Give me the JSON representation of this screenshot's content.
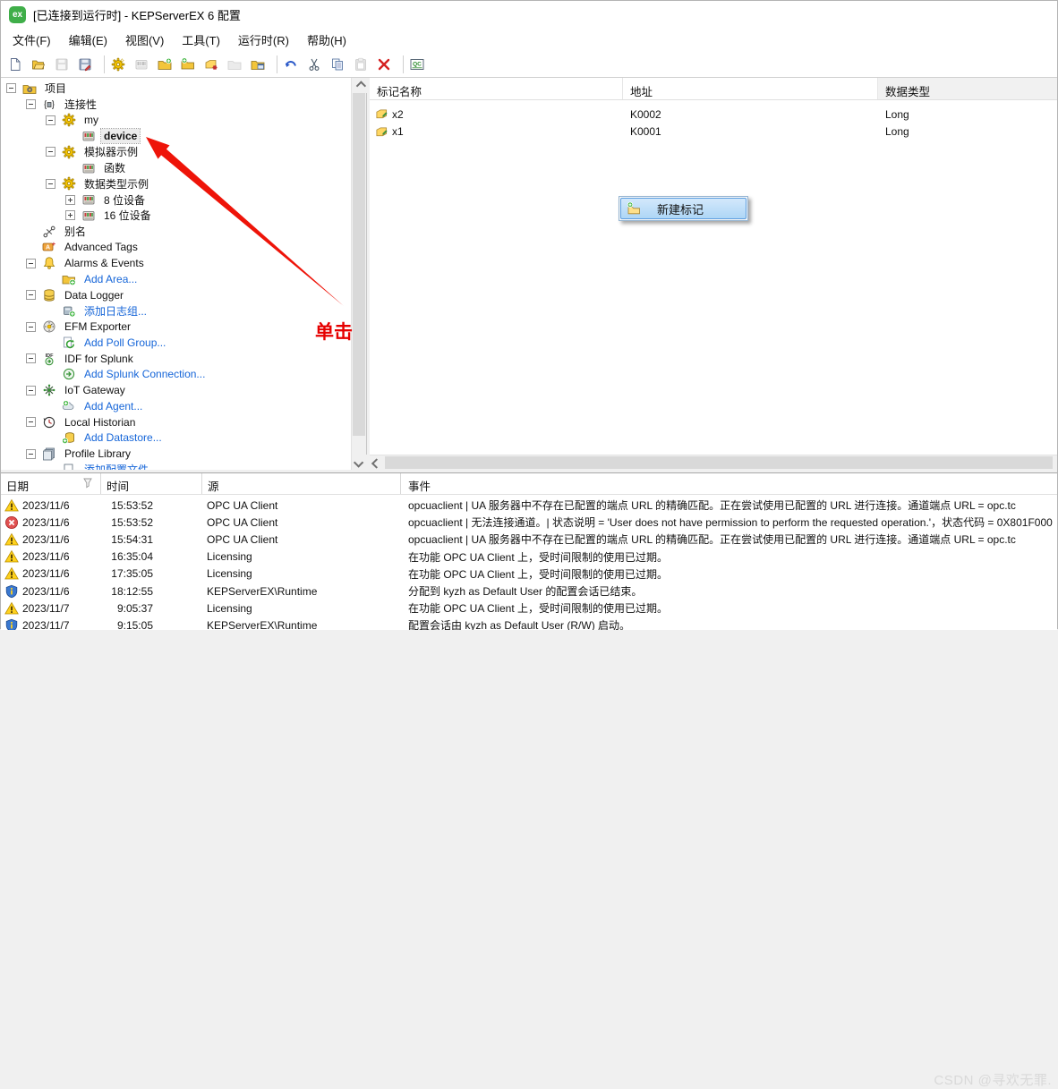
{
  "window": {
    "title": "[已连接到运行时] - KEPServerEX 6 配置",
    "app_icon": "kepserverex-logo",
    "app_icon_color": "#3fae49",
    "app_icon_text": "ex"
  },
  "menu_bar": {
    "items": [
      "文件(F)",
      "编辑(E)",
      "视图(V)",
      "工具(T)",
      "运行时(R)",
      "帮助(H)"
    ]
  },
  "toolbar": {
    "buttons": [
      {
        "icon": "new-project",
        "enabled": true
      },
      {
        "icon": "open-project",
        "enabled": true
      },
      {
        "icon": "save-project",
        "enabled": false
      },
      {
        "icon": "save-as",
        "enabled": true
      },
      {
        "sep": true
      },
      {
        "icon": "new-channel",
        "enabled": true
      },
      {
        "icon": "new-device",
        "enabled": false
      },
      {
        "icon": "new-tag-group",
        "enabled": true
      },
      {
        "icon": "new-tag-folder",
        "enabled": true
      },
      {
        "icon": "new-tag",
        "enabled": true
      },
      {
        "icon": "folder",
        "enabled": false
      },
      {
        "icon": "properties",
        "enabled": true
      },
      {
        "sep": true
      },
      {
        "icon": "undo",
        "enabled": true
      },
      {
        "icon": "cut",
        "enabled": true
      },
      {
        "icon": "copy",
        "enabled": true
      },
      {
        "icon": "paste",
        "enabled": false
      },
      {
        "icon": "delete",
        "enabled": true
      },
      {
        "sep": true
      },
      {
        "icon": "quick-client",
        "enabled": true
      }
    ]
  },
  "tree": {
    "items": [
      {
        "level": 0,
        "expander": "minus",
        "icon": "project-folder",
        "label": "项目"
      },
      {
        "level": 1,
        "expander": "minus",
        "icon": "connectivity",
        "label": "连接性"
      },
      {
        "level": 2,
        "expander": "minus",
        "icon": "channel",
        "label": "my"
      },
      {
        "level": 3,
        "expander": null,
        "icon": "device",
        "label": "device",
        "selected": true
      },
      {
        "level": 2,
        "expander": "minus",
        "icon": "channel",
        "label": "模拟器示例"
      },
      {
        "level": 3,
        "expander": null,
        "icon": "device",
        "label": "函数"
      },
      {
        "level": 2,
        "expander": "minus",
        "icon": "channel",
        "label": "数据类型示例"
      },
      {
        "level": 3,
        "expander": "plus",
        "icon": "device",
        "label": "8 位设备"
      },
      {
        "level": 3,
        "expander": "plus",
        "icon": "device",
        "label": "16 位设备"
      },
      {
        "level": 1,
        "expander": null,
        "icon": "alias",
        "label": "别名"
      },
      {
        "level": 1,
        "expander": null,
        "icon": "advanced-tags",
        "label": "Advanced Tags"
      },
      {
        "level": 1,
        "expander": "minus",
        "icon": "alarms-events",
        "label": "Alarms & Events"
      },
      {
        "level": 2,
        "expander": null,
        "icon": "add-area",
        "label": "Add Area...",
        "link": true
      },
      {
        "level": 1,
        "expander": "minus",
        "icon": "data-logger",
        "label": "Data Logger"
      },
      {
        "level": 2,
        "expander": null,
        "icon": "add-log-group",
        "label": "添加日志组...",
        "link": true
      },
      {
        "level": 1,
        "expander": "minus",
        "icon": "efm-exporter",
        "label": "EFM Exporter"
      },
      {
        "level": 2,
        "expander": null,
        "icon": "add-poll-group",
        "label": "Add Poll Group...",
        "link": true
      },
      {
        "level": 1,
        "expander": "minus",
        "icon": "idf-splunk",
        "label": "IDF for Splunk"
      },
      {
        "level": 2,
        "expander": null,
        "icon": "add-splunk-connection",
        "label": "Add Splunk Connection...",
        "link": true
      },
      {
        "level": 1,
        "expander": "minus",
        "icon": "iot-gateway",
        "label": "IoT Gateway"
      },
      {
        "level": 2,
        "expander": null,
        "icon": "add-agent",
        "label": "Add Agent...",
        "link": true
      },
      {
        "level": 1,
        "expander": "minus",
        "icon": "local-historian",
        "label": "Local Historian"
      },
      {
        "level": 2,
        "expander": null,
        "icon": "add-datastore",
        "label": "Add Datastore...",
        "link": true
      },
      {
        "level": 1,
        "expander": "minus",
        "icon": "profile-library",
        "label": "Profile Library"
      },
      {
        "level": 2,
        "expander": null,
        "icon": "add-profile",
        "label": "添加配置文件",
        "link": true
      }
    ]
  },
  "tag_list": {
    "columns": [
      "标记名称",
      "地址",
      "数据类型"
    ],
    "rows": [
      {
        "icon": "tag",
        "name": "x2",
        "address": "K0002",
        "type": "Long"
      },
      {
        "icon": "tag",
        "name": "x1",
        "address": "K0001",
        "type": "Long"
      }
    ]
  },
  "context_menu": {
    "items": [
      {
        "icon": "new-tag-menu",
        "label": "新建标记",
        "highlighted": true
      }
    ]
  },
  "annotation": {
    "label": "单击",
    "color": "#e60000"
  },
  "event_log": {
    "columns": [
      "日期",
      "时间",
      "源",
      "事件"
    ],
    "rows": [
      {
        "severity": "warning",
        "date": "2023/11/6",
        "time": "15:53:52",
        "source": "OPC UA Client",
        "event": "opcuaclient | UA 服务器中不存在已配置的端点 URL 的精确匹配。正在尝试使用已配置的 URL 进行连接。通道端点 URL = opc.tc"
      },
      {
        "severity": "error",
        "date": "2023/11/6",
        "time": "15:53:52",
        "source": "OPC UA Client",
        "event": "opcuaclient | 无法连接通道。| 状态说明 = 'User does not have permission to perform the requested operation.'，状态代码 = 0X801F000"
      },
      {
        "severity": "warning",
        "date": "2023/11/6",
        "time": "15:54:31",
        "source": "OPC UA Client",
        "event": "opcuaclient | UA 服务器中不存在已配置的端点 URL 的精确匹配。正在尝试使用已配置的 URL 进行连接。通道端点 URL = opc.tc"
      },
      {
        "severity": "warning",
        "date": "2023/11/6",
        "time": "16:35:04",
        "source": "Licensing",
        "event": "在功能 OPC UA Client 上，受时间限制的使用已过期。"
      },
      {
        "severity": "warning",
        "date": "2023/11/6",
        "time": "17:35:05",
        "source": "Licensing",
        "event": "在功能 OPC UA Client 上，受时间限制的使用已过期。"
      },
      {
        "severity": "info",
        "date": "2023/11/6",
        "time": "18:12:55",
        "source": "KEPServerEX\\Runtime",
        "event": "分配到 kyzh as Default User 的配置会话已结束。"
      },
      {
        "severity": "warning",
        "date": "2023/11/7",
        "time": "9:05:37",
        "source": "Licensing",
        "event": "在功能 OPC UA Client 上，受时间限制的使用已过期。"
      },
      {
        "severity": "info",
        "date": "2023/11/7",
        "time": "9:15:05",
        "source": "KEPServerEX\\Runtime",
        "event": "配置会话由 kyzh as Default User (R/W) 启动。"
      }
    ]
  },
  "watermark": "CSDN @寻欢无罪."
}
